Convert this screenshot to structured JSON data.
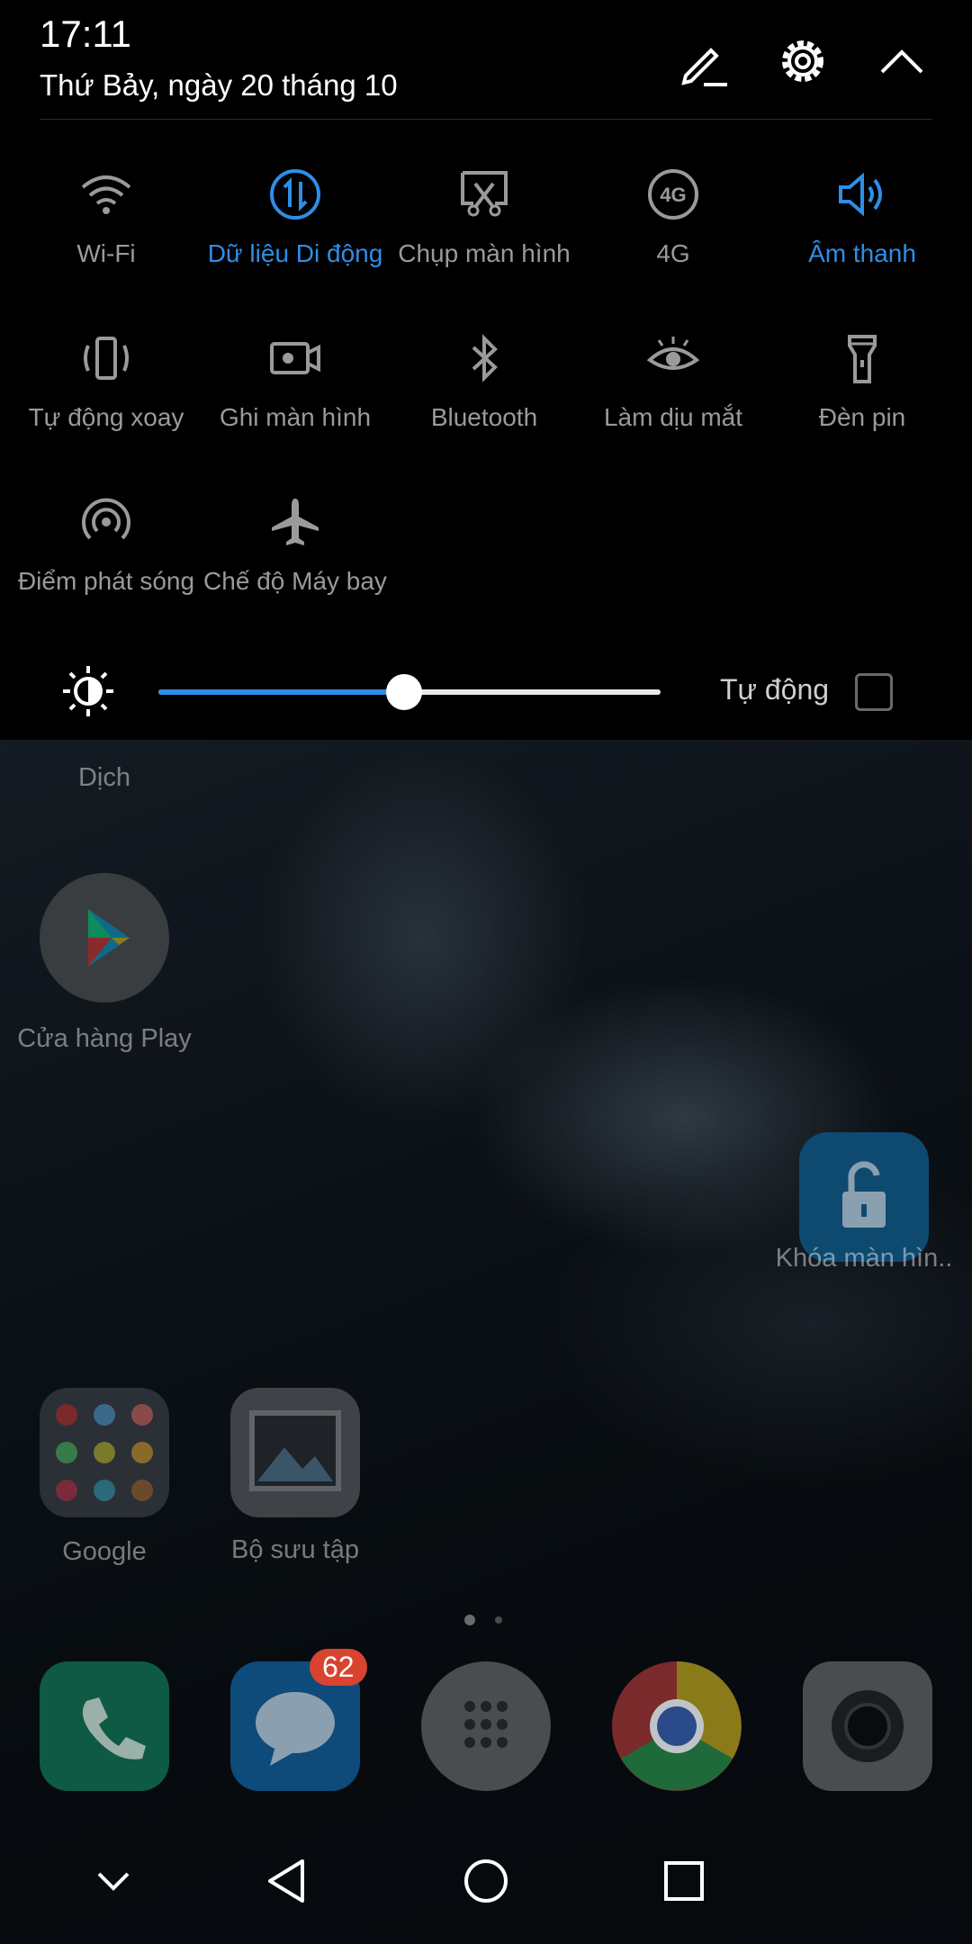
{
  "status": {
    "time": "17:11",
    "date": "Thứ Bảy, ngày 20 tháng 10"
  },
  "header_icons": {
    "edit": "edit-icon",
    "settings": "gear-icon",
    "collapse": "chevron-up-icon"
  },
  "tiles": [
    {
      "label": "Wi-Fi",
      "icon": "wifi-icon",
      "active": false
    },
    {
      "label": "Dữ liệu Di động",
      "icon": "mobile-data-icon",
      "active": true
    },
    {
      "label": "Chụp màn hình",
      "icon": "screenshot-icon",
      "active": false
    },
    {
      "label": "4G",
      "icon": "4g-icon",
      "active": false
    },
    {
      "label": "Âm thanh",
      "icon": "sound-icon",
      "active": true
    },
    {
      "label": "Tự động xoay",
      "icon": "auto-rotate-icon",
      "active": false
    },
    {
      "label": "Ghi màn hình",
      "icon": "screen-record-icon",
      "active": false
    },
    {
      "label": "Bluetooth",
      "icon": "bluetooth-icon",
      "active": false
    },
    {
      "label": "Làm dịu mắt",
      "icon": "eye-comfort-icon",
      "active": false
    },
    {
      "label": "Đèn pin",
      "icon": "flashlight-icon",
      "active": false
    },
    {
      "label": "Điểm phát sóng",
      "icon": "hotspot-icon",
      "active": false
    },
    {
      "label": "Chế độ Máy bay",
      "icon": "airplane-icon",
      "active": false
    }
  ],
  "brightness": {
    "level": 0.49,
    "auto_label": "Tự động",
    "auto_checked": false
  },
  "home": {
    "apps": {
      "dich": "Dịch",
      "play": "Cửa hàng Play",
      "lock": "Khóa màn hìn..",
      "google": "Google",
      "gallery": "Bộ sưu tập"
    },
    "messages_badge": "62",
    "page_dots": 2,
    "dock": [
      "phone-icon",
      "messages-icon",
      "app-drawer-icon",
      "chrome-icon",
      "camera-icon"
    ]
  },
  "navbar": [
    "chevron-down-icon",
    "back-icon",
    "home-icon",
    "recents-icon"
  ],
  "colors": {
    "accent": "#2e8ee6",
    "panel_bg": "#000000",
    "inactive": "#9a9a9a"
  }
}
